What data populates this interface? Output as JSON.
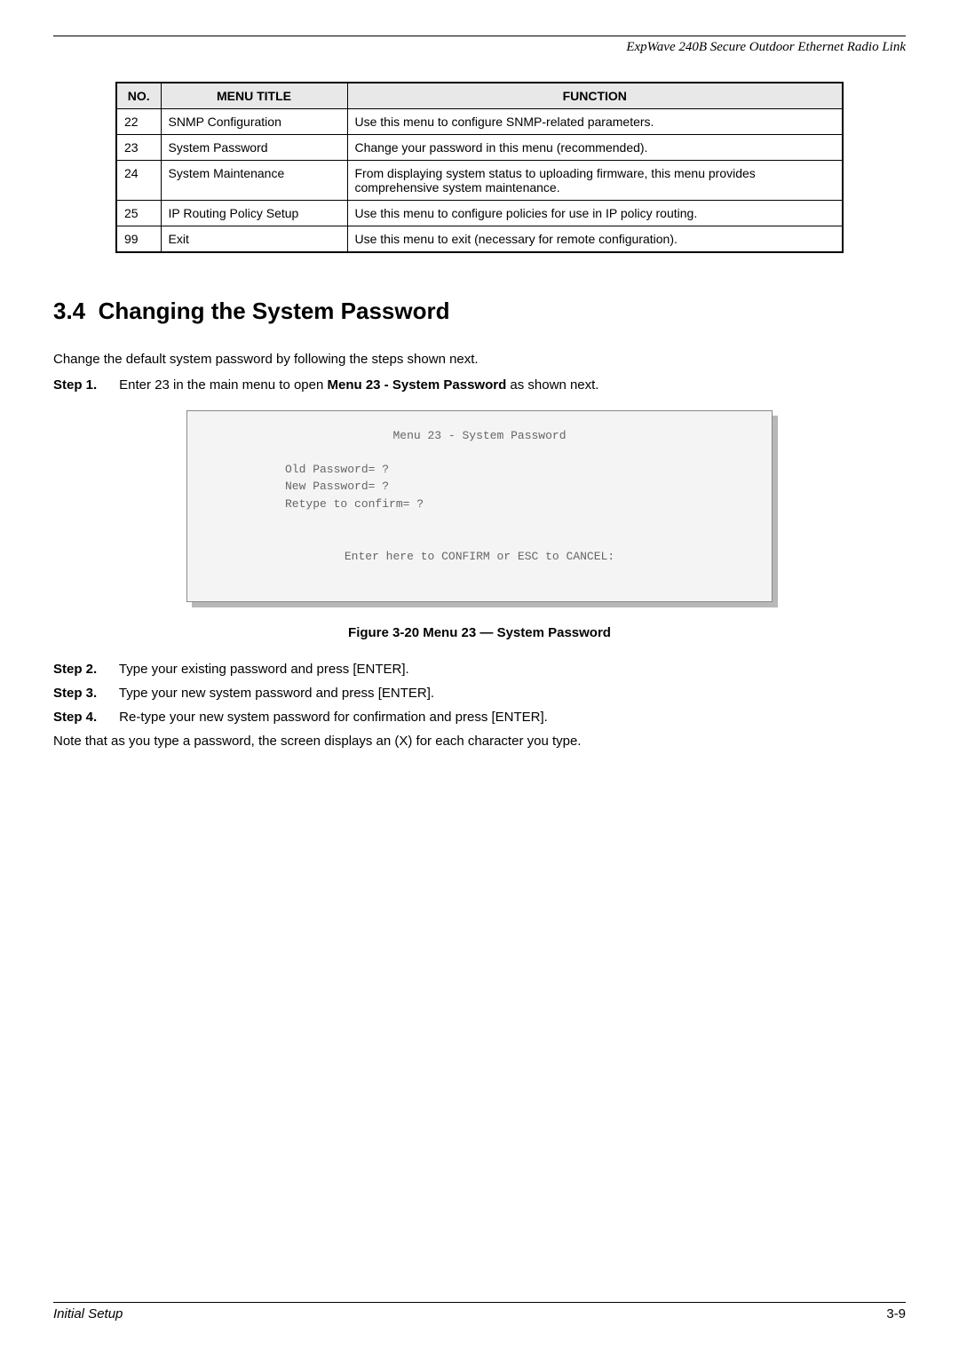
{
  "header": {
    "doc_title": "ExpWave 240B Secure Outdoor Ethernet Radio Link"
  },
  "table": {
    "headers": [
      "NO.",
      "MENU TITLE",
      "FUNCTION"
    ],
    "rows": [
      {
        "no": "22",
        "title": "SNMP Configuration",
        "func": "Use this menu to configure SNMP-related parameters."
      },
      {
        "no": "23",
        "title": "System Password",
        "func": "Change your password in this menu (recommended)."
      },
      {
        "no": "24",
        "title": "System Maintenance",
        "func": "From displaying system status to uploading firmware, this menu provides comprehensive system maintenance."
      },
      {
        "no": "25",
        "title": "IP Routing Policy Setup",
        "func": "Use this menu to configure policies for use in IP policy routing."
      },
      {
        "no": "99",
        "title": "Exit",
        "func": "Use this menu to exit (necessary for remote configuration)."
      }
    ]
  },
  "section": {
    "number": "3.4",
    "title": "Changing the System Password"
  },
  "intro": "Change the default system password by following the steps shown next.",
  "step1": {
    "label": "Step 1.",
    "before": "Enter 23 in the main menu to open ",
    "bold": "Menu 23 - System Password",
    "after": " as shown next."
  },
  "codebox": {
    "title": "Menu 23 - System Password",
    "line1": "Old Password= ?",
    "line2": "New Password= ?",
    "line3": "Retype to confirm= ?",
    "footer": "Enter here to CONFIRM or ESC to CANCEL:"
  },
  "figure_caption": "Figure 3-20 Menu 23 — System Password",
  "step2": {
    "label": "Step 2.",
    "text": "Type your existing password and press [ENTER]."
  },
  "step3": {
    "label": "Step 3.",
    "text": "Type your new system password and press [ENTER]."
  },
  "step4": {
    "label": "Step 4.",
    "text": "Re-type your new system password for confirmation and press [ENTER]."
  },
  "note": "Note that as you type a password, the screen displays an (X) for each character you type.",
  "footer": {
    "left": "Initial Setup",
    "right": "3-9"
  }
}
